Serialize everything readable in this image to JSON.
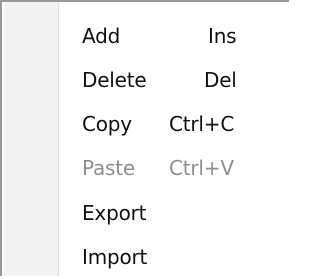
{
  "context_menu": {
    "items": [
      {
        "label": "Add",
        "shortcut": "Ins",
        "enabled": true
      },
      {
        "label": "Delete",
        "shortcut": "Del",
        "enabled": true
      },
      {
        "label": "Copy",
        "shortcut": "Ctrl+C",
        "enabled": true
      },
      {
        "label": "Paste",
        "shortcut": "Ctrl+V",
        "enabled": false
      },
      {
        "label": "Export",
        "shortcut": "",
        "enabled": true
      },
      {
        "label": "Import",
        "shortcut": "",
        "enabled": true
      }
    ]
  }
}
